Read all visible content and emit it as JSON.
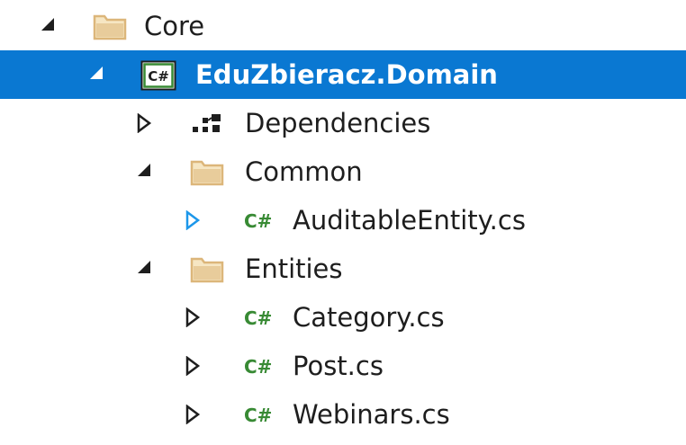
{
  "solution_explorer": {
    "nodes": [
      {
        "label": "Core",
        "icon": "folder-icon",
        "expander": "expanded"
      },
      {
        "label": "EduZbieracz.Domain",
        "icon": "csharp-project-icon",
        "icon_text": "C#",
        "expander": "expanded",
        "selected": true
      },
      {
        "label": "Dependencies",
        "icon": "dependencies-icon",
        "expander": "collapsed"
      },
      {
        "label": "Common",
        "icon": "folder-icon",
        "expander": "expanded"
      },
      {
        "label": "AuditableEntity.cs",
        "icon": "csharp-file-icon",
        "icon_text": "C#",
        "expander": "collapsed-hover"
      },
      {
        "label": "Entities",
        "icon": "folder-icon",
        "expander": "expanded"
      },
      {
        "label": "Category.cs",
        "icon": "csharp-file-icon",
        "icon_text": "C#",
        "expander": "collapsed"
      },
      {
        "label": "Post.cs",
        "icon": "csharp-file-icon",
        "icon_text": "C#",
        "expander": "collapsed"
      },
      {
        "label": "Webinars.cs",
        "icon": "csharp-file-icon",
        "icon_text": "C#",
        "expander": "collapsed"
      }
    ]
  },
  "colors": {
    "selection": "#0a78d2",
    "folder": "#dcb67a",
    "csharp": "#388a34",
    "expander": "#1e1e1e",
    "expander_hover": "#1c97ea"
  }
}
